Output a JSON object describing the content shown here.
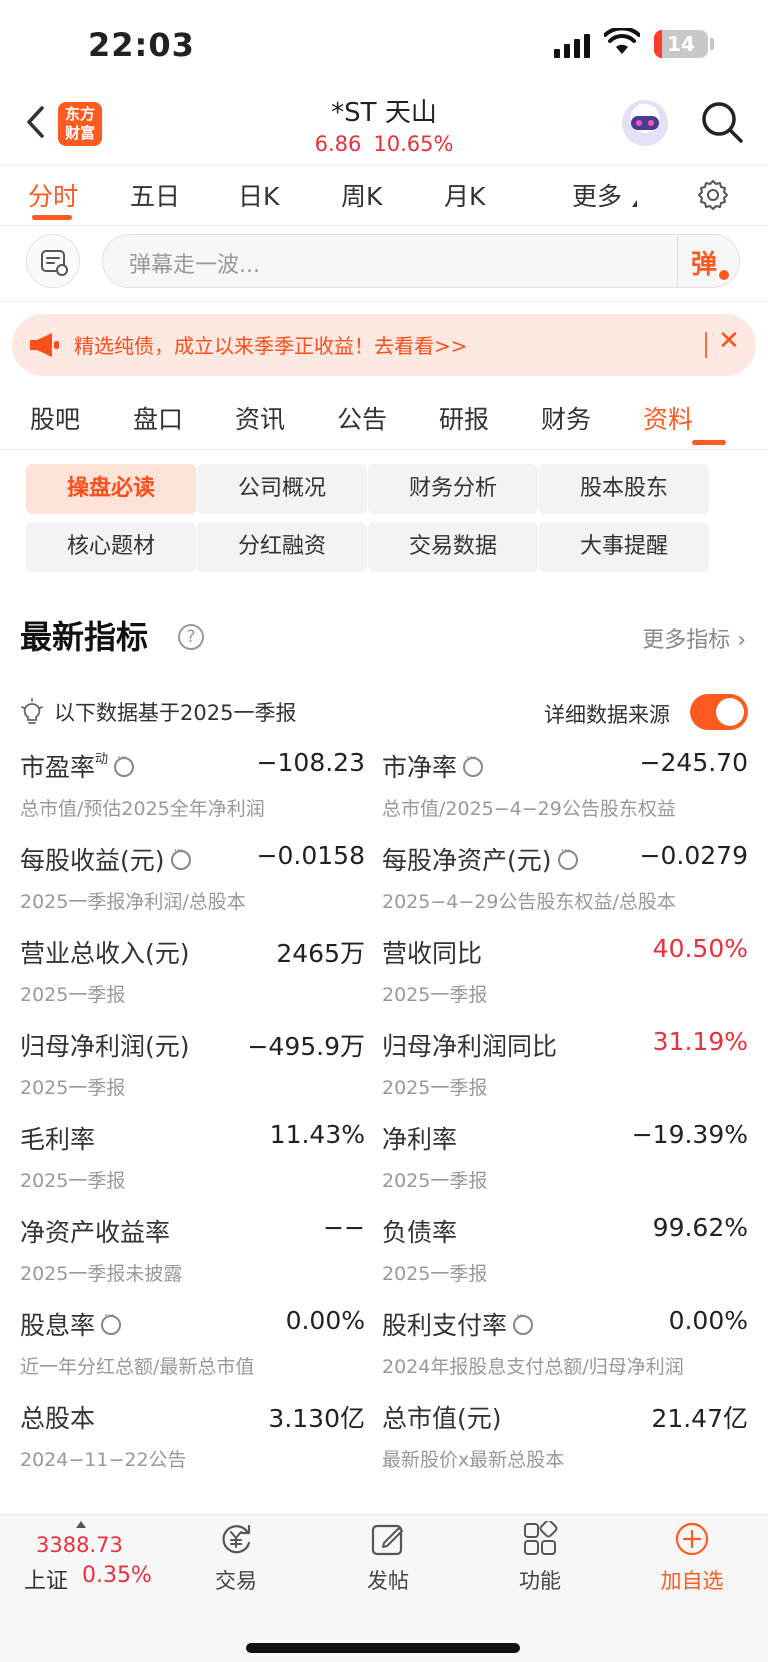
{
  "status_bar": {
    "time": "22:03",
    "battery": "14",
    "battery_level": 0.14
  },
  "header": {
    "logo_top": "东方",
    "logo_bottom": "财富",
    "stock_name": "*ST 天山",
    "price": "6.86",
    "change_pct": "10.65%"
  },
  "chart_tabs": [
    "分时",
    "五日",
    "日K",
    "周K",
    "月K",
    "更多"
  ],
  "danmaku": {
    "placeholder": "弹幕走一波...",
    "button": "弹"
  },
  "banner": {
    "text": "精选纯债，成立以来季季正收益！去看看>>",
    "close": "✕"
  },
  "section_tabs": [
    "股吧",
    "盘口",
    "资讯",
    "公告",
    "研报",
    "财务",
    "资料"
  ],
  "chips": [
    "操盘必读",
    "公司概况",
    "财务分析",
    "股本股东",
    "核心题材",
    "分红融资",
    "交易数据",
    "大事提醒"
  ],
  "indicators": {
    "title": "最新指标",
    "help": "?",
    "more": "更多指标 ›",
    "basis": "以下数据基于2025一季报",
    "source_label": "详细数据来源",
    "source_toggle_on": true,
    "items": [
      {
        "label": "市盈率",
        "sup": "动",
        "value": "−108.23",
        "sub": "总市值/预估2025全年净利润"
      },
      {
        "label": "市净率",
        "value": "−245.70",
        "sub": "总市值/2025−4−29公告股东权益"
      },
      {
        "label": "每股收益(元)",
        "value": "−0.0158",
        "sub": "2025一季报净利润/总股本"
      },
      {
        "label": "每股净资产(元)",
        "value": "−0.0279",
        "sub": "2025−4−29公告股东权益/总股本"
      },
      {
        "label": "营业总收入(元)",
        "value": "2465万",
        "sub": "2025一季报"
      },
      {
        "label": "营收同比",
        "value": "40.50%",
        "sub": "2025一季报"
      },
      {
        "label": "归母净利润(元)",
        "value": "−495.9万",
        "sub": "2025一季报"
      },
      {
        "label": "归母净利润同比",
        "value": "31.19%",
        "sub": "2025一季报"
      },
      {
        "label": "毛利率",
        "value": "11.43%",
        "sub": "2025一季报"
      },
      {
        "label": "净利率",
        "value": "−19.39%",
        "sub": "2025一季报"
      },
      {
        "label": "净资产收益率",
        "value": "−−",
        "sub": "2025一季报未披露"
      },
      {
        "label": "负债率",
        "value": "99.62%",
        "sub": "2025一季报"
      },
      {
        "label": "股息率",
        "value": "0.00%",
        "sub": "近一年分红总额/最新总市值"
      },
      {
        "label": "股利支付率",
        "value": "0.00%",
        "sub": "2024年报股息支付总额/归母净利润"
      },
      {
        "label": "总股本",
        "value": "3.130亿",
        "sub": "2024−11−22公告"
      },
      {
        "label": "总市值(元)",
        "value": "21.47亿",
        "sub": "最新股价x最新总股本"
      }
    ]
  },
  "bottom_bar": {
    "index_value": "3388.73",
    "index_name": "上证",
    "index_change": "0.35%",
    "buttons": [
      "交易",
      "发帖",
      "功能",
      "加自选"
    ]
  },
  "colors": {
    "accent": "#ff5a1f",
    "up": "#e8313a",
    "chip_active_bg": "#fde3d8",
    "banner_bg": "#fde9e1"
  }
}
